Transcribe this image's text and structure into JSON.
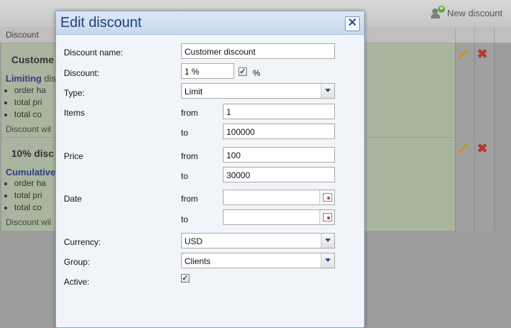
{
  "background": {
    "new_discount_label": "New discount",
    "column_header": "Discount",
    "rows": [
      {
        "title": "Custome",
        "type": "Limiting",
        "type_suffix": "dis",
        "items": [
          "order ha",
          "total pri",
          "total co"
        ],
        "note": "Discount wil"
      },
      {
        "title": "10% disc",
        "type": "Cumulative",
        "type_suffix": "",
        "items": [
          "order ha",
          "total pri",
          "total co"
        ],
        "note": "Discount wil"
      }
    ]
  },
  "dialog": {
    "title": "Edit discount",
    "close_glyph": "✕",
    "fields": {
      "discount_name": {
        "label": "Discount name:",
        "value": "Customer discount"
      },
      "discount": {
        "label": "Discount:",
        "value": "1 %",
        "percent_label": "%",
        "percent_checked": true
      },
      "type": {
        "label": "Type:",
        "value": "Limit"
      },
      "items": {
        "label": "Items",
        "from_label": "from",
        "from_value": "1",
        "to_label": "to",
        "to_value": "100000"
      },
      "price": {
        "label": "Price",
        "from_label": "from",
        "from_value": "100",
        "to_label": "to",
        "to_value": "30000"
      },
      "date": {
        "label": "Date",
        "from_label": "from",
        "from_value": "",
        "to_label": "to",
        "to_value": ""
      },
      "currency": {
        "label": "Currency:",
        "value": "USD"
      },
      "group": {
        "label": "Group:",
        "value": "Clients"
      },
      "active": {
        "label": "Active:",
        "checked": true
      }
    }
  },
  "colors": {
    "dialog_title": "#1f3f79",
    "type_link": "#2d3e82",
    "delete_red": "#b53a2e",
    "check_mark": "#253d74"
  }
}
